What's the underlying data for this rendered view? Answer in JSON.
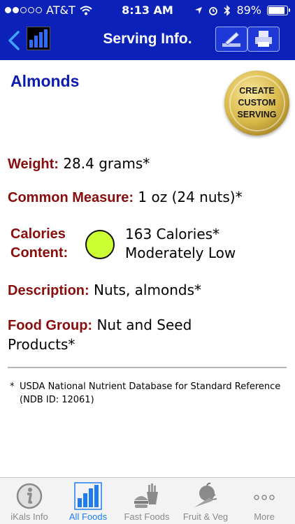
{
  "status": {
    "carrier": "AT&T",
    "time": "8:13 AM",
    "battery": "89%",
    "battery_level": 0.89,
    "signal_bars_filled": 2
  },
  "nav": {
    "title": "Serving Info."
  },
  "food": {
    "name": "Almonds",
    "custom_button": "CREATE\nCUSTOM\nSERVING",
    "weight_label": "Weight:",
    "weight_value": "28.4 grams*",
    "measure_label": "Common Measure:",
    "measure_value": "1 oz (24 nuts)*",
    "calories_label": "Calories Content:",
    "calories_value": "163 Calories*",
    "calories_level": "Moderately Low",
    "calories_indicator_color": "#ccff33",
    "description_label": "Description:",
    "description_value": "Nuts, almonds*",
    "group_label": "Food Group:",
    "group_value": "Nut and Seed Products*"
  },
  "footnote": {
    "star": "*",
    "text": "USDA National Nutrient Database for Standard Reference (NDB ID: 12061)"
  },
  "tabs": [
    {
      "label": "iKals Info",
      "icon": "info-icon",
      "active": false
    },
    {
      "label": "All Foods",
      "icon": "bar-chart-icon",
      "active": true
    },
    {
      "label": "Fast Foods",
      "icon": "burger-fries-icon",
      "active": false
    },
    {
      "label": "Fruit & Veg",
      "icon": "apple-carrot-icon",
      "active": false
    },
    {
      "label": "More",
      "icon": "more-dots-icon",
      "active": false
    }
  ],
  "colors": {
    "header_blue": "#0c21b8",
    "label_red": "#8a0d0d",
    "title_blue": "#0b1cb0",
    "tab_active": "#1e7cf0"
  }
}
